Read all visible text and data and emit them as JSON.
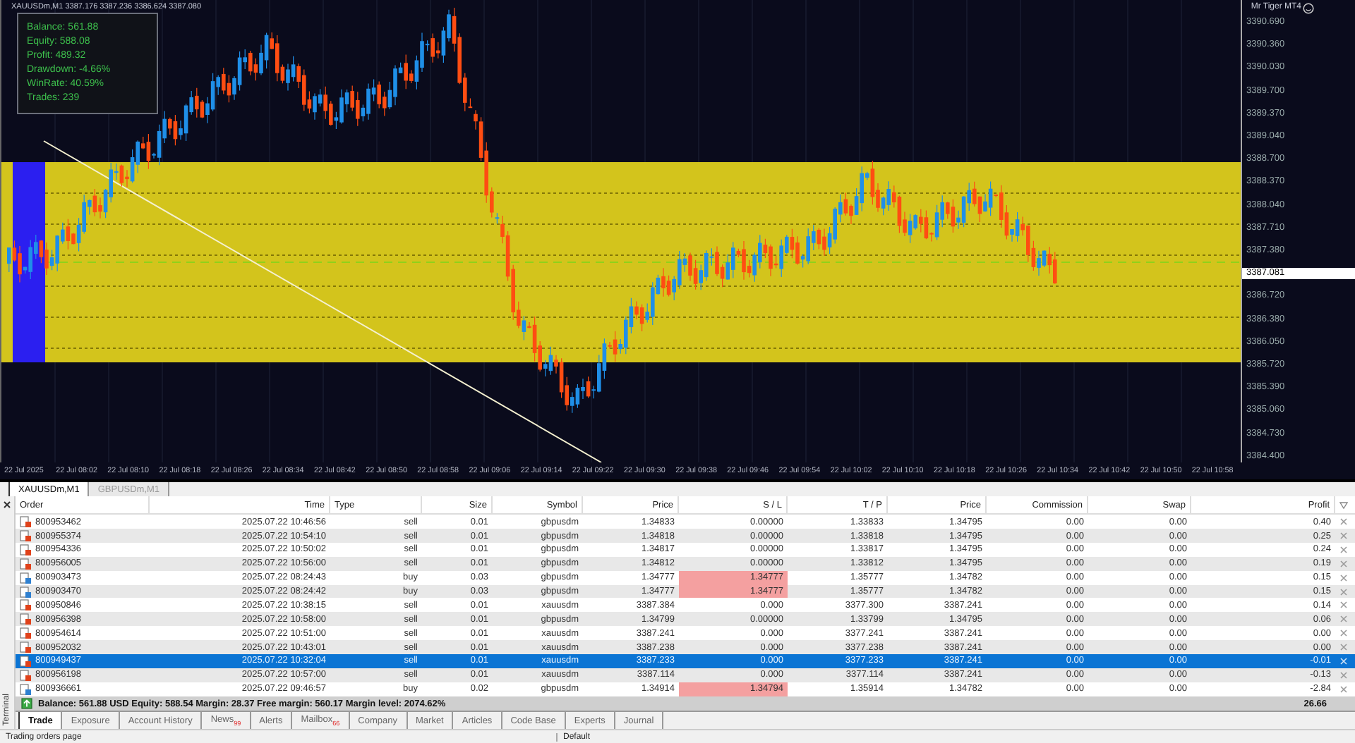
{
  "chart": {
    "header": "XAUUSDm,M1  3387.176 3387.236 3386.624 3387.080",
    "indicator": "Mr Tiger MT4",
    "info_panel": [
      "Balance: 561.88",
      "Equity: 588.08",
      "Profit: 489.32",
      "Drawdown: -4.66%",
      "WinRate: 40.59%",
      "Trades: 239"
    ],
    "price_axis": [
      {
        "label": "3390.690",
        "kind": "tick"
      },
      {
        "label": "3390.360",
        "kind": "tick"
      },
      {
        "label": "3390.030",
        "kind": "tick"
      },
      {
        "label": "3389.700",
        "kind": "tick"
      },
      {
        "label": "3389.370",
        "kind": "tick"
      },
      {
        "label": "3389.040",
        "kind": "tick"
      },
      {
        "label": "3388.700",
        "kind": "tick"
      },
      {
        "label": "3388.370",
        "kind": "tick"
      },
      {
        "label": "3388.040",
        "kind": "tick"
      },
      {
        "label": "3387.710",
        "kind": "tick"
      },
      {
        "label": "3387.380",
        "kind": "tick"
      },
      {
        "label": "3387.081",
        "kind": "current"
      },
      {
        "label": "3386.720",
        "kind": "tick"
      },
      {
        "label": "3386.380",
        "kind": "tick"
      },
      {
        "label": "3386.050",
        "kind": "tick"
      },
      {
        "label": "3385.720",
        "kind": "tick"
      },
      {
        "label": "3385.390",
        "kind": "tick"
      },
      {
        "label": "3385.060",
        "kind": "tick"
      },
      {
        "label": "3384.730",
        "kind": "tick"
      },
      {
        "label": "3384.400",
        "kind": "tick"
      }
    ],
    "time_axis": [
      "22 Jul 2025",
      "22 Jul 08:02",
      "22 Jul 08:10",
      "22 Jul 08:18",
      "22 Jul 08:26",
      "22 Jul 08:34",
      "22 Jul 08:42",
      "22 Jul 08:50",
      "22 Jul 08:58",
      "22 Jul 09:06",
      "22 Jul 09:14",
      "22 Jul 09:22",
      "22 Jul 09:30",
      "22 Jul 09:38",
      "22 Jul 09:46",
      "22 Jul 09:54",
      "22 Jul 10:02",
      "22 Jul 10:10",
      "22 Jul 10:18",
      "22 Jul 10:26",
      "22 Jul 10:34",
      "22 Jul 10:42",
      "22 Jul 10:50",
      "22 Jul 10:58"
    ]
  },
  "chart_tabs": [
    {
      "label": "XAUUSDm,M1",
      "selected": true
    },
    {
      "label": "GBPUSDm,M1",
      "selected": false
    }
  ],
  "table": {
    "columns": [
      "Order",
      "Time",
      "Type",
      "Size",
      "Symbol",
      "Price",
      "S / L",
      "T / P",
      "Price",
      "Commission",
      "Swap",
      "Profit"
    ],
    "rows": [
      {
        "kind": "sell",
        "selected": false,
        "sl_alert": false,
        "cells": [
          "800953462",
          "2025.07.22 10:46:56",
          "sell",
          "0.01",
          "gbpusdm",
          "1.34833",
          "0.00000",
          "1.33833",
          "1.34795",
          "0.00",
          "0.00",
          "0.40"
        ]
      },
      {
        "kind": "sell",
        "selected": false,
        "sl_alert": false,
        "cells": [
          "800955374",
          "2025.07.22 10:54:10",
          "sell",
          "0.01",
          "gbpusdm",
          "1.34818",
          "0.00000",
          "1.33818",
          "1.34795",
          "0.00",
          "0.00",
          "0.25"
        ]
      },
      {
        "kind": "sell",
        "selected": false,
        "sl_alert": false,
        "cells": [
          "800954336",
          "2025.07.22 10:50:02",
          "sell",
          "0.01",
          "gbpusdm",
          "1.34817",
          "0.00000",
          "1.33817",
          "1.34795",
          "0.00",
          "0.00",
          "0.24"
        ]
      },
      {
        "kind": "sell",
        "selected": false,
        "sl_alert": false,
        "cells": [
          "800956005",
          "2025.07.22 10:56:00",
          "sell",
          "0.01",
          "gbpusdm",
          "1.34812",
          "0.00000",
          "1.33812",
          "1.34795",
          "0.00",
          "0.00",
          "0.19"
        ]
      },
      {
        "kind": "buy",
        "selected": false,
        "sl_alert": true,
        "cells": [
          "800903473",
          "2025.07.22 08:24:43",
          "buy",
          "0.03",
          "gbpusdm",
          "1.34777",
          "1.34777",
          "1.35777",
          "1.34782",
          "0.00",
          "0.00",
          "0.15"
        ]
      },
      {
        "kind": "buy",
        "selected": false,
        "sl_alert": true,
        "cells": [
          "800903470",
          "2025.07.22 08:24:42",
          "buy",
          "0.03",
          "gbpusdm",
          "1.34777",
          "1.34777",
          "1.35777",
          "1.34782",
          "0.00",
          "0.00",
          "0.15"
        ]
      },
      {
        "kind": "sell",
        "selected": false,
        "sl_alert": false,
        "cells": [
          "800950846",
          "2025.07.22 10:38:15",
          "sell",
          "0.01",
          "xauusdm",
          "3387.384",
          "0.000",
          "3377.300",
          "3387.241",
          "0.00",
          "0.00",
          "0.14"
        ]
      },
      {
        "kind": "sell",
        "selected": false,
        "sl_alert": false,
        "cells": [
          "800956398",
          "2025.07.22 10:58:00",
          "sell",
          "0.01",
          "gbpusdm",
          "1.34799",
          "0.00000",
          "1.33799",
          "1.34795",
          "0.00",
          "0.00",
          "0.06"
        ]
      },
      {
        "kind": "sell",
        "selected": false,
        "sl_alert": false,
        "cells": [
          "800954614",
          "2025.07.22 10:51:00",
          "sell",
          "0.01",
          "xauusdm",
          "3387.241",
          "0.000",
          "3377.241",
          "3387.241",
          "0.00",
          "0.00",
          "0.00"
        ]
      },
      {
        "kind": "sell",
        "selected": false,
        "sl_alert": false,
        "cells": [
          "800952032",
          "2025.07.22 10:43:01",
          "sell",
          "0.01",
          "xauusdm",
          "3387.238",
          "0.000",
          "3377.238",
          "3387.241",
          "0.00",
          "0.00",
          "0.00"
        ]
      },
      {
        "kind": "sell",
        "selected": true,
        "sl_alert": false,
        "cells": [
          "800949437",
          "2025.07.22 10:32:04",
          "sell",
          "0.01",
          "xauusdm",
          "3387.233",
          "0.000",
          "3377.233",
          "3387.241",
          "0.00",
          "0.00",
          "-0.01"
        ]
      },
      {
        "kind": "sell",
        "selected": false,
        "sl_alert": false,
        "cells": [
          "800956198",
          "2025.07.22 10:57:00",
          "sell",
          "0.01",
          "xauusdm",
          "3387.114",
          "0.000",
          "3377.114",
          "3387.241",
          "0.00",
          "0.00",
          "-0.13"
        ]
      },
      {
        "kind": "buy",
        "selected": false,
        "sl_alert": true,
        "cells": [
          "800936661",
          "2025.07.22 09:46:57",
          "buy",
          "0.02",
          "gbpusdm",
          "1.34914",
          "1.34794",
          "1.35914",
          "1.34782",
          "0.00",
          "0.00",
          "-2.84"
        ]
      }
    ],
    "summary": "Balance: 561.88 USD  Equity: 588.54  Margin: 28.37  Free margin: 560.17  Margin level: 2074.62%",
    "total": "26.66"
  },
  "terminal_label": "Terminal",
  "terminal_tabs": [
    {
      "label": "Trade",
      "selected": true
    },
    {
      "label": "Exposure",
      "selected": false
    },
    {
      "label": "Account History",
      "selected": false
    },
    {
      "label": "News",
      "badge": "99",
      "selected": false
    },
    {
      "label": "Alerts",
      "selected": false
    },
    {
      "label": "Mailbox",
      "badge": "66",
      "selected": false
    },
    {
      "label": "Company",
      "selected": false
    },
    {
      "label": "Market",
      "selected": false
    },
    {
      "label": "Articles",
      "selected": false
    },
    {
      "label": "Code Base",
      "selected": false
    },
    {
      "label": "Experts",
      "selected": false
    },
    {
      "label": "Journal",
      "selected": false
    }
  ],
  "status_bar": [
    "Trading orders page",
    "Default"
  ]
}
